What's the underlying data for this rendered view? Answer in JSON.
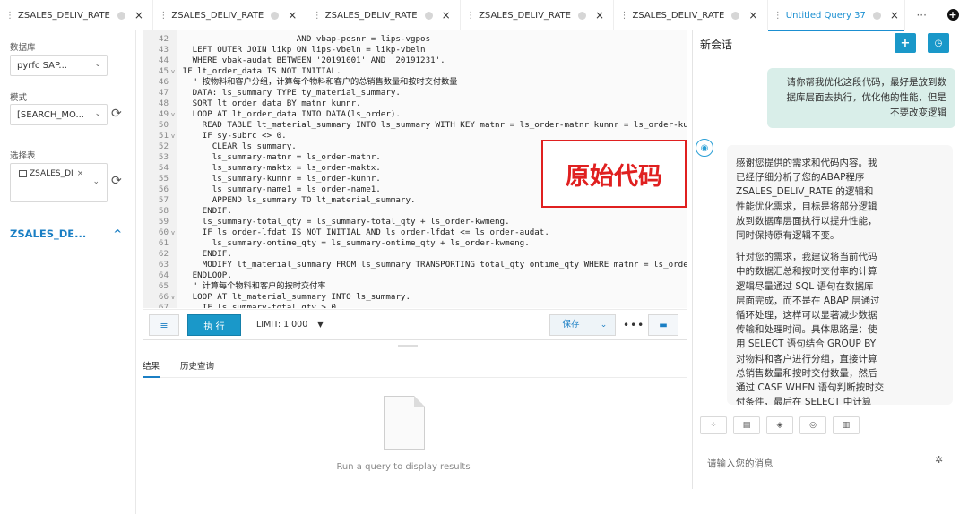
{
  "tabs": [
    {
      "label": "ZSALES_DELIV_RATE",
      "active": false
    },
    {
      "label": "ZSALES_DELIV_RATE",
      "active": false
    },
    {
      "label": "ZSALES_DELIV_RATE",
      "active": false
    },
    {
      "label": "ZSALES_DELIV_RATE",
      "active": false
    },
    {
      "label": "ZSALES_DELIV_RATE",
      "active": false
    },
    {
      "label": "Untitled Query 37",
      "active": true
    }
  ],
  "tab_more_label": "···",
  "tab_close": "×",
  "sidebar": {
    "database_label": "数据库",
    "database_value": "pyrfc    SAP...",
    "schema_label": "模式",
    "schema_value": "[SEARCH_MO...",
    "table_label": "选择表",
    "table_chip": "ZSALES_DI",
    "chip_close": "×",
    "section_title": "ZSALES_DE...",
    "section_chevron": "^"
  },
  "editor": {
    "lines": [
      {
        "n": "42",
        "f": "",
        "t": "                        AND vbap-posnr = lips-vgpos"
      },
      {
        "n": "43",
        "f": "",
        "t": "   LEFT OUTER JOIN likp ON lips-vbeln = likp-vbeln"
      },
      {
        "n": "44",
        "f": "",
        "t": "   WHERE vbak-audat BETWEEN '20191001' AND '20191231'."
      },
      {
        "n": "45",
        "f": "v",
        "t": " IF lt_order_data IS NOT INITIAL."
      },
      {
        "n": "46",
        "f": "",
        "t": "   \" 按物料和客户分组，计算每个物料和客户的总销售数量和按时交付数量"
      },
      {
        "n": "47",
        "f": "",
        "t": "   DATA: ls_summary TYPE ty_material_summary."
      },
      {
        "n": "48",
        "f": "",
        "t": "   SORT lt_order_data BY matnr kunnr."
      },
      {
        "n": "49",
        "f": "v",
        "t": "   LOOP AT lt_order_data INTO DATA(ls_order)."
      },
      {
        "n": "50",
        "f": "",
        "t": "     READ TABLE lt_material_summary INTO ls_summary WITH KEY matnr = ls_order-matnr kunnr = ls_order-kunnr"
      },
      {
        "n": "51",
        "f": "v",
        "t": "     IF sy-subrc <> 0."
      },
      {
        "n": "52",
        "f": "",
        "t": "       CLEAR ls_summary."
      },
      {
        "n": "53",
        "f": "",
        "t": "       ls_summary-matnr = ls_order-matnr."
      },
      {
        "n": "54",
        "f": "",
        "t": "       ls_summary-maktx = ls_order-maktx."
      },
      {
        "n": "55",
        "f": "",
        "t": "       ls_summary-kunnr = ls_order-kunnr."
      },
      {
        "n": "56",
        "f": "",
        "t": "       ls_summary-name1 = ls_order-name1."
      },
      {
        "n": "57",
        "f": "",
        "t": "       APPEND ls_summary TO lt_material_summary."
      },
      {
        "n": "58",
        "f": "",
        "t": "     ENDIF."
      },
      {
        "n": "59",
        "f": "",
        "t": "     ls_summary-total_qty = ls_summary-total_qty + ls_order-kwmeng."
      },
      {
        "n": "60",
        "f": "v",
        "t": "     IF ls_order-lfdat IS NOT INITIAL AND ls_order-lfdat <= ls_order-audat."
      },
      {
        "n": "61",
        "f": "",
        "t": "       ls_summary-ontime_qty = ls_summary-ontime_qty + ls_order-kwmeng."
      },
      {
        "n": "62",
        "f": "",
        "t": "     ENDIF."
      },
      {
        "n": "63",
        "f": "",
        "t": "     MODIFY lt_material_summary FROM ls_summary TRANSPORTING total_qty ontime_qty WHERE matnr = ls_order-matnr"
      },
      {
        "n": "64",
        "f": "",
        "t": "   ENDLOOP."
      },
      {
        "n": "65",
        "f": "",
        "t": "   \" 计算每个物料和客户的按时交付率"
      },
      {
        "n": "66",
        "f": "v",
        "t": "   LOOP AT lt_material_summary INTO ls_summary."
      },
      {
        "n": "67",
        "f": "",
        "t": "     IF ls_summary-total_qty > 0."
      }
    ],
    "overlay_label": "原始代码",
    "run_label": "执 行",
    "limit_label": "LIMIT:  1 000",
    "save_label": "保存"
  },
  "results": {
    "tab_results": "结果",
    "tab_history": "历史查询",
    "empty_text": "Run a query to display results"
  },
  "chat": {
    "title": "新会话",
    "new_btn": "+",
    "user_message": "请你帮我优化这段代码，最好是放到数\n据库层面去执行，优化他的性能，但是\n不要改变逻辑",
    "ai_p1": "感谢您提供的需求和代码内容。我\n已经仔细分析了您的ABAP程序\nZSALES_DELIV_RATE 的逻辑和\n性能优化需求，目标是将部分逻辑\n放到数据库层面执行以提升性能，\n同时保持原有逻辑不变。",
    "ai_p2": "针对您的需求，我建议将当前代码\n中的数据汇总和按时交付率的计算\n逻辑尽量通过 SQL 语句在数据库\n层面完成，而不是在 ABAP 层通过\n循环处理，这样可以显著减少数据\n传输和处理时间。具体思路是：使\n用 SELECT 语句结合 GROUP BY\n对物料和客户进行分组，直接计算\n总销售数量和按时交付数量，然后\n通过 CASE WHEN 语句判断按时交\n付条件，最后在 SELECT 中计算\n交付率",
    "input_placeholder": "请输入您的消息"
  }
}
